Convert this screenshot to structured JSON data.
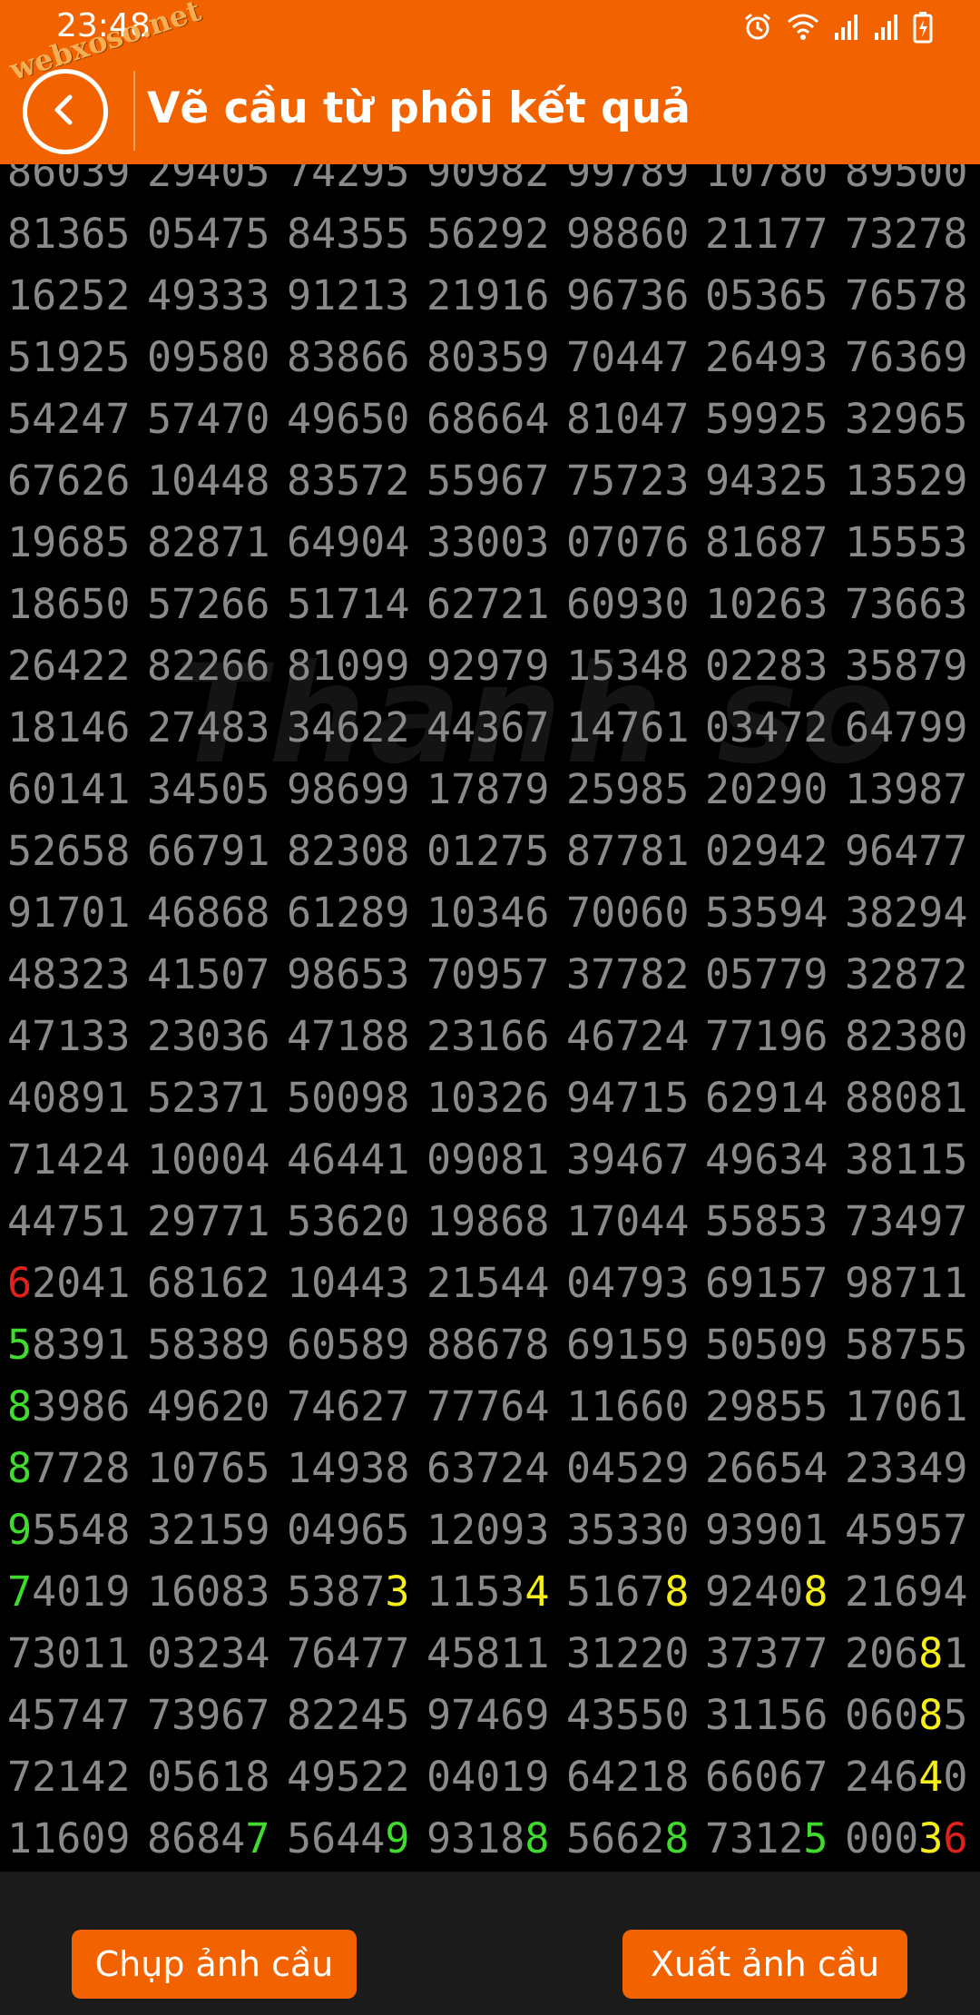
{
  "status_bar": {
    "time": "23:48",
    "watermark": "webxoso.net",
    "icons": [
      "alarm-icon",
      "wifi-icon",
      "signal-icon",
      "signal-icon",
      "battery-icon"
    ]
  },
  "header": {
    "title": "Vẽ cầu từ phôi kết quả",
    "back_icon": "chevron-left-icon"
  },
  "grid_watermark": "Thanh so",
  "grid": {
    "rows": [
      [
        "86039",
        "29405",
        "74295",
        "90982",
        "99789",
        "10780",
        "89500"
      ],
      [
        "81365",
        "05475",
        "84355",
        "56292",
        "98860",
        "21177",
        "73278"
      ],
      [
        "16252",
        "49333",
        "91213",
        "21916",
        "96736",
        "05365",
        "76578"
      ],
      [
        "51925",
        "09580",
        "83866",
        "80359",
        "70447",
        "26493",
        "76369"
      ],
      [
        "54247",
        "57470",
        "49650",
        "68664",
        "81047",
        "59925",
        "32965"
      ],
      [
        "67626",
        "10448",
        "83572",
        "55967",
        "75723",
        "94325",
        "13529"
      ],
      [
        "19685",
        "82871",
        "64904",
        "33003",
        "07076",
        "81687",
        "15553"
      ],
      [
        "18650",
        "57266",
        "51714",
        "62721",
        "60930",
        "10263",
        "73663"
      ],
      [
        "26422",
        "82266",
        "81099",
        "92979",
        "15348",
        "02283",
        "35879"
      ],
      [
        "18146",
        "27483",
        "34622",
        "44367",
        "14761",
        "03472",
        "64799"
      ],
      [
        "60141",
        "34505",
        "98699",
        "17879",
        "25985",
        "20290",
        "13987"
      ],
      [
        "52658",
        "66791",
        "82308",
        "01275",
        "87781",
        "02942",
        "96477"
      ],
      [
        "91701",
        "46868",
        "61289",
        "10346",
        "70060",
        "53594",
        "38294"
      ],
      [
        "48323",
        "41507",
        "98653",
        "70957",
        "37782",
        "05779",
        "32872"
      ],
      [
        "47133",
        "23036",
        "47188",
        "23166",
        "46724",
        "77196",
        "82380"
      ],
      [
        "40891",
        "52371",
        "50098",
        "10326",
        "94715",
        "62914",
        "88081"
      ],
      [
        "71424",
        "10004",
        "46441",
        "09081",
        "39467",
        "49634",
        "38115"
      ],
      [
        "44751",
        "29771",
        "53620",
        "19868",
        "17044",
        "55853",
        "73497"
      ],
      [
        "62041",
        "68162",
        "10443",
        "21544",
        "04793",
        "69157",
        "98711"
      ],
      [
        "58391",
        "58389",
        "60589",
        "88678",
        "69159",
        "50509",
        "58755"
      ],
      [
        "83986",
        "49620",
        "74627",
        "77764",
        "11660",
        "29855",
        "17061"
      ],
      [
        "87728",
        "10765",
        "14938",
        "63724",
        "04529",
        "26654",
        "23349"
      ],
      [
        "95548",
        "32159",
        "04965",
        "12093",
        "35330",
        "93901",
        "45957"
      ],
      [
        "74019",
        "16083",
        "53873",
        "11534",
        "51678",
        "92408",
        "21694"
      ],
      [
        "73011",
        "03234",
        "76477",
        "45811",
        "31220",
        "37377",
        "20681"
      ],
      [
        "45747",
        "73967",
        "82245",
        "97469",
        "43550",
        "31156",
        "06085"
      ],
      [
        "72142",
        "05618",
        "49522",
        "04019",
        "64218",
        "66067",
        "24640"
      ],
      [
        "11609",
        "86847",
        "56449",
        "93188",
        "56628",
        "73125",
        "00036"
      ]
    ],
    "highlights": [
      {
        "row": 18,
        "col": 0,
        "ch": 0,
        "color": "red"
      },
      {
        "row": 19,
        "col": 0,
        "ch": 0,
        "color": "green"
      },
      {
        "row": 20,
        "col": 0,
        "ch": 0,
        "color": "green"
      },
      {
        "row": 21,
        "col": 0,
        "ch": 0,
        "color": "green"
      },
      {
        "row": 22,
        "col": 0,
        "ch": 0,
        "color": "green"
      },
      {
        "row": 23,
        "col": 0,
        "ch": 0,
        "color": "green"
      },
      {
        "row": 23,
        "col": 2,
        "ch": 4,
        "color": "yellow"
      },
      {
        "row": 23,
        "col": 3,
        "ch": 4,
        "color": "yellow"
      },
      {
        "row": 23,
        "col": 4,
        "ch": 4,
        "color": "yellow"
      },
      {
        "row": 23,
        "col": 5,
        "ch": 4,
        "color": "yellow"
      },
      {
        "row": 24,
        "col": 6,
        "ch": 3,
        "color": "yellow"
      },
      {
        "row": 25,
        "col": 6,
        "ch": 3,
        "color": "yellow"
      },
      {
        "row": 26,
        "col": 6,
        "ch": 3,
        "color": "yellow"
      },
      {
        "row": 27,
        "col": 1,
        "ch": 4,
        "color": "green"
      },
      {
        "row": 27,
        "col": 2,
        "ch": 4,
        "color": "green"
      },
      {
        "row": 27,
        "col": 3,
        "ch": 4,
        "color": "green"
      },
      {
        "row": 27,
        "col": 4,
        "ch": 4,
        "color": "green"
      },
      {
        "row": 27,
        "col": 5,
        "ch": 4,
        "color": "green"
      },
      {
        "row": 27,
        "col": 6,
        "ch": 3,
        "color": "yellow"
      },
      {
        "row": 27,
        "col": 6,
        "ch": 4,
        "color": "red"
      }
    ]
  },
  "buttons": {
    "capture": "Chụp ảnh cầu",
    "export": "Xuất ảnh cầu"
  },
  "colors": {
    "accent": "#f26300",
    "digit": "#8a8a8a",
    "red": "#e0201a",
    "green": "#3fdc2e",
    "yellow": "#f5ee17"
  }
}
